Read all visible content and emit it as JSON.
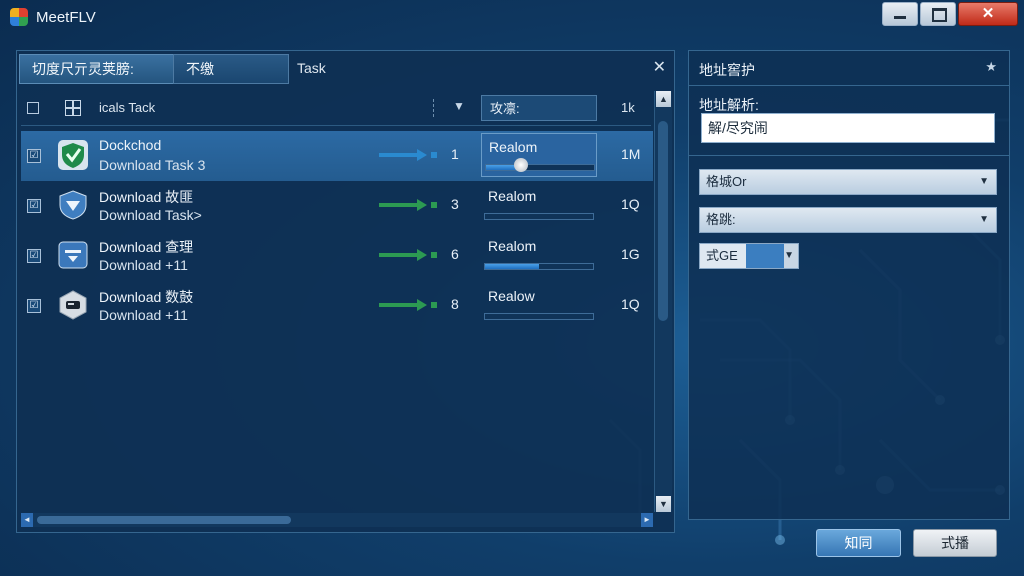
{
  "window": {
    "title": "MeetFLV",
    "close_glyph": "✕"
  },
  "tabs": [
    {
      "label": "切度尺亓灵荚膀:"
    },
    {
      "label": "不缴"
    },
    {
      "label": "Task"
    }
  ],
  "tabs_close": "✕",
  "list_header": {
    "name": "icals Tack",
    "speed": "攻凛:",
    "size": "1k",
    "sort_glyph": "▼"
  },
  "rows": [
    {
      "checked": "☑",
      "icon": "shield-check-icon",
      "name": "Dockchod",
      "sub": "Download Task 3",
      "num": "1",
      "status": "Realom",
      "progress": 0.33,
      "size": "1M",
      "selected": true
    },
    {
      "checked": "☑",
      "icon": "shield-down-icon",
      "name": "Download 故匪",
      "sub": "Download Task>",
      "num": "3",
      "status": "Realom",
      "progress": 0.0,
      "size": "1Q",
      "selected": false
    },
    {
      "checked": "☑",
      "icon": "inbox-icon",
      "name": "Download 查理",
      "sub": "Download +11",
      "num": "6",
      "status": "Realom",
      "progress": 0.5,
      "size": "1G",
      "selected": false
    },
    {
      "checked": "☑",
      "icon": "drive-icon",
      "name": "Download 数鼓",
      "sub": "Download +11",
      "num": "8",
      "status": "Realow",
      "progress": 0.0,
      "size": "1Q",
      "selected": false
    }
  ],
  "right_panel": {
    "title": "地址窖护",
    "pin_glyph": "★",
    "address_label": "地址解析:",
    "address_value": "解/尽究闹",
    "select1": "格城Or",
    "select2": "格跳:",
    "select3": "式GE",
    "dd_glyph": "▼"
  },
  "buttons": {
    "ok": "知同",
    "cancel": "式播"
  },
  "scroll": {
    "up": "▲",
    "down": "▼",
    "left": "◄",
    "right": "►"
  },
  "colors": {
    "accent": "#2c6aa4",
    "arrow_blue": "#2a8ad0",
    "arrow_green": "#2c9a52",
    "progress": "#2f86d6"
  }
}
